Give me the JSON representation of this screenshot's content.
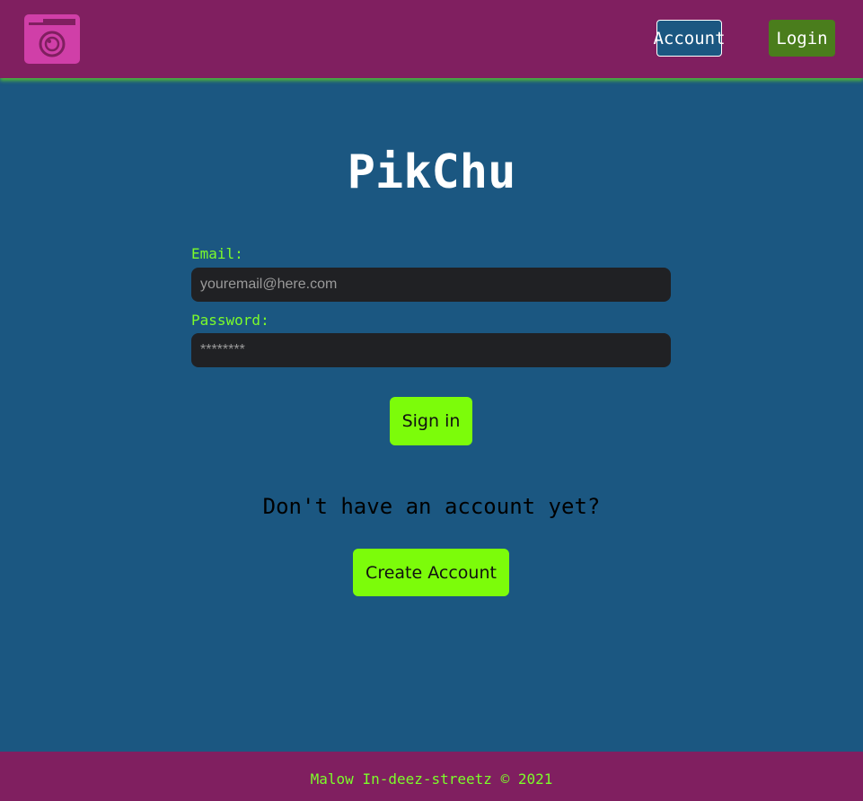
{
  "colors": {
    "navbar_bg": "#801f60",
    "page_bg": "#1b5781",
    "accent_green": "#7cfc0a",
    "login_button_bg": "#4a7d1c",
    "logo_pink": "#d03fa8",
    "input_bg": "#202124"
  },
  "navbar": {
    "logo_icon": "camera-icon",
    "account_label": "Account",
    "login_label": "Login"
  },
  "main": {
    "title": "PikChu",
    "email_label": "Email:",
    "email_placeholder": "youremail@here.com",
    "password_label": "Password:",
    "password_placeholder": "********",
    "signin_label": "Sign in",
    "signup_prompt": "Don't have an account yet?",
    "create_account_label": "Create Account"
  },
  "footer": {
    "text": "Malow In-deez-streetz © 2021"
  }
}
